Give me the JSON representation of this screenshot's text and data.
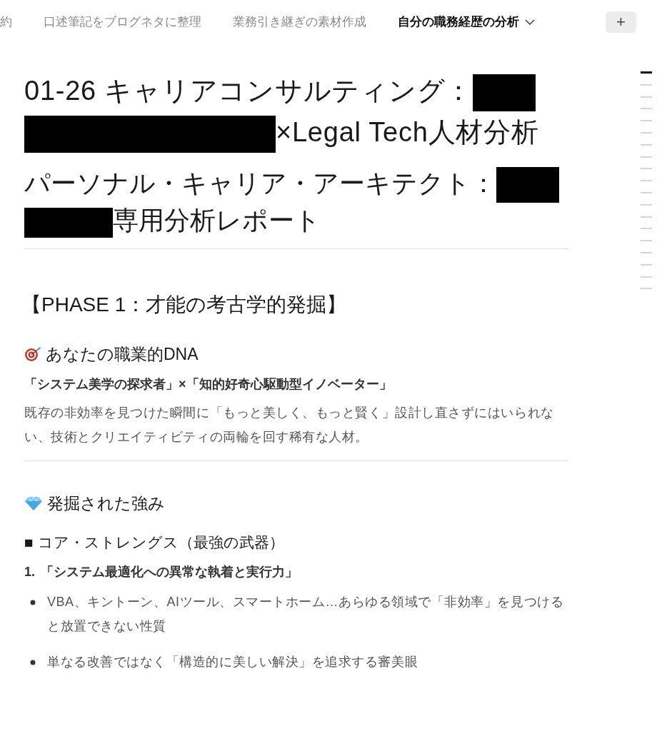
{
  "tabs": [
    {
      "label": "約",
      "selected": false
    },
    {
      "label": "口述筆記をブログネタに整理",
      "selected": false
    },
    {
      "label": "業務引き継ぎの素材作成",
      "selected": false
    },
    {
      "label": "自分の職務経歴の分析",
      "selected": true
    }
  ],
  "add_tab": "+",
  "title": [
    {
      "kind": "text",
      "text": "01-26 キャリアコンサルティング："
    },
    {
      "kind": "redacted_short"
    },
    {
      "kind": "redacted_long"
    },
    {
      "kind": "text",
      "text": "×Legal Tech人材分析"
    }
  ],
  "subtitle": [
    {
      "kind": "text",
      "text": "パーソナル・キャリア・アーキテクト："
    },
    {
      "kind": "redacted_short"
    },
    {
      "kind": "redacted_medium"
    },
    {
      "kind": "text",
      "text": "専用分析レポート"
    }
  ],
  "blocks": [
    {
      "kind": "h2",
      "text": "【PHASE 1：才能の考古学的発掘】"
    },
    {
      "kind": "h3",
      "text": "あなたの職業的DNA"
    },
    {
      "kind": "bold",
      "text": "「システム美学の探求者」×「知的好奇心駆動型イノベーター」"
    },
    {
      "kind": "para",
      "text": "既存の非効率を見つけた瞬間に「もっと美しく、もっと賢く」設計し直さずにはいられない、技術とクリエイティビティの両輪を回す稀有な人材。"
    },
    {
      "kind": "divider"
    },
    {
      "kind": "h3",
      "text": "発掘された強み"
    },
    {
      "kind": "h4",
      "text": "■ コア・ストレングス（最強の武器）"
    },
    {
      "kind": "numbered",
      "number": "1.",
      "text": "「システム最適化への異常な執着と実行力」"
    },
    {
      "kind": "bullet",
      "text": "VBA、キントーン、AIツール、スマートホーム…あらゆる領域で「非効率」を見つけると放置できない性質"
    },
    {
      "kind": "bullet",
      "text": "単なる改善ではなく「構造的に美しい解決」を追求する審美眼"
    }
  ],
  "outline_marks": [
    {
      "selected": true
    },
    {
      "selected": false
    },
    {
      "selected": false
    },
    {
      "selected": false
    },
    {
      "selected": false
    },
    {
      "selected": false
    },
    {
      "selected": false
    },
    {
      "selected": false
    },
    {
      "selected": false
    },
    {
      "selected": false
    },
    {
      "selected": false
    },
    {
      "selected": false
    },
    {
      "selected": false
    },
    {
      "selected": false
    },
    {
      "selected": false
    },
    {
      "selected": false
    },
    {
      "selected": false
    },
    {
      "selected": false
    },
    {
      "selected": false
    }
  ]
}
